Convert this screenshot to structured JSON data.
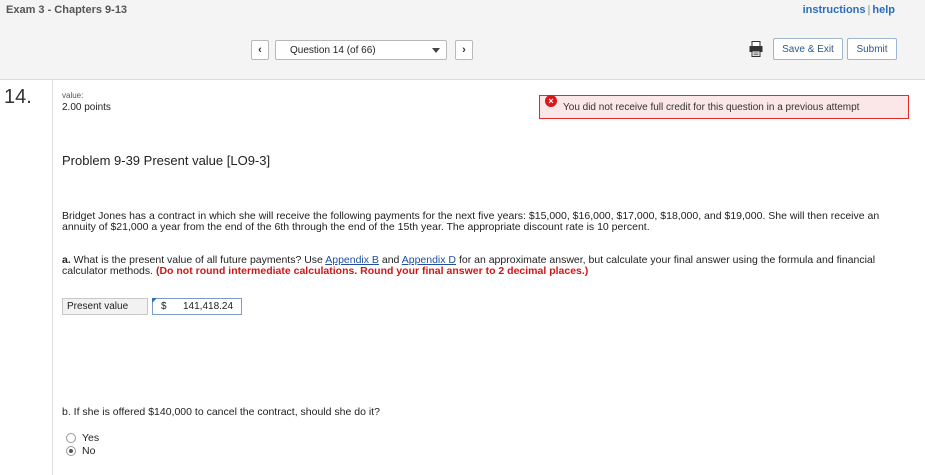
{
  "header": {
    "exam_title": "Exam 3 - Chapters 9-13",
    "instructions_link": "instructions",
    "separator": "|",
    "help_link": "help",
    "question_select": "Question 14 (of 66)",
    "save_exit_label": "Save & Exit",
    "submit_label": "Submit"
  },
  "question": {
    "number": "14.",
    "value_label": "value:",
    "points": "2.00 points",
    "alert_text": "You did not receive full credit for this question in a previous attempt",
    "title": "Problem 9-39 Present value [LO9-3]",
    "paragraph1": "Bridget Jones has a contract in which she will receive the following payments for the next five years: $15,000, $16,000, $17,000, $18,000, and $19,000. She will then receive an annuity of $21,000 a year from the end of the 6th through the end of the 15th year. The appropriate discount rate is 10 percent.",
    "part_a": {
      "label": "a.",
      "text_before": " What is the present value of all future payments? Use ",
      "link1": "Appendix B",
      "text_middle": " and ",
      "link2": "Appendix D",
      "text_after": " for an approximate answer, but calculate your final answer using the formula and financial calculator methods. ",
      "instruction": "(Do not round intermediate calculations. Round your final answer to 2 decimal places.)"
    },
    "present_value": {
      "label": "Present value",
      "currency": "$",
      "amount": "141,418.24"
    },
    "part_b": {
      "text": "b. If she is offered $140,000 to cancel the contract, should she do it?",
      "options": [
        {
          "label": "Yes",
          "selected": false
        },
        {
          "label": "No",
          "selected": true
        }
      ]
    }
  },
  "colors": {
    "link": "#1f4fa0",
    "alert_border": "#e12b2b",
    "alert_bg": "#fbe7e7",
    "instruction_red": "#d01616"
  }
}
